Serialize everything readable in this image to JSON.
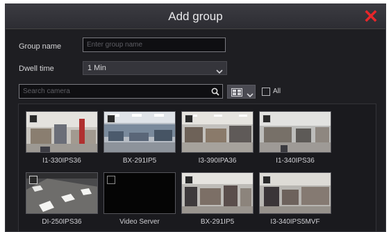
{
  "dialog": {
    "title": "Add group"
  },
  "form": {
    "group_name_label": "Group name",
    "group_name_placeholder": "Enter group name",
    "group_name_value": "",
    "dwell_time_label": "Dwell time",
    "dwell_time_value": "1 Min"
  },
  "search": {
    "placeholder": "Search camera",
    "all_label": "All"
  },
  "cameras": [
    {
      "name": "I1-330IPS36"
    },
    {
      "name": "BX-291IP5"
    },
    {
      "name": "I3-390IPA36"
    },
    {
      "name": "I1-340IPS36"
    },
    {
      "name": "DI-250IPS36"
    },
    {
      "name": "Video Server"
    },
    {
      "name": "BX-291IP5"
    },
    {
      "name": "I3-340IPS5MVF"
    }
  ],
  "colors": {
    "accent_close": "#e8262a",
    "background": "#1e1e22"
  }
}
